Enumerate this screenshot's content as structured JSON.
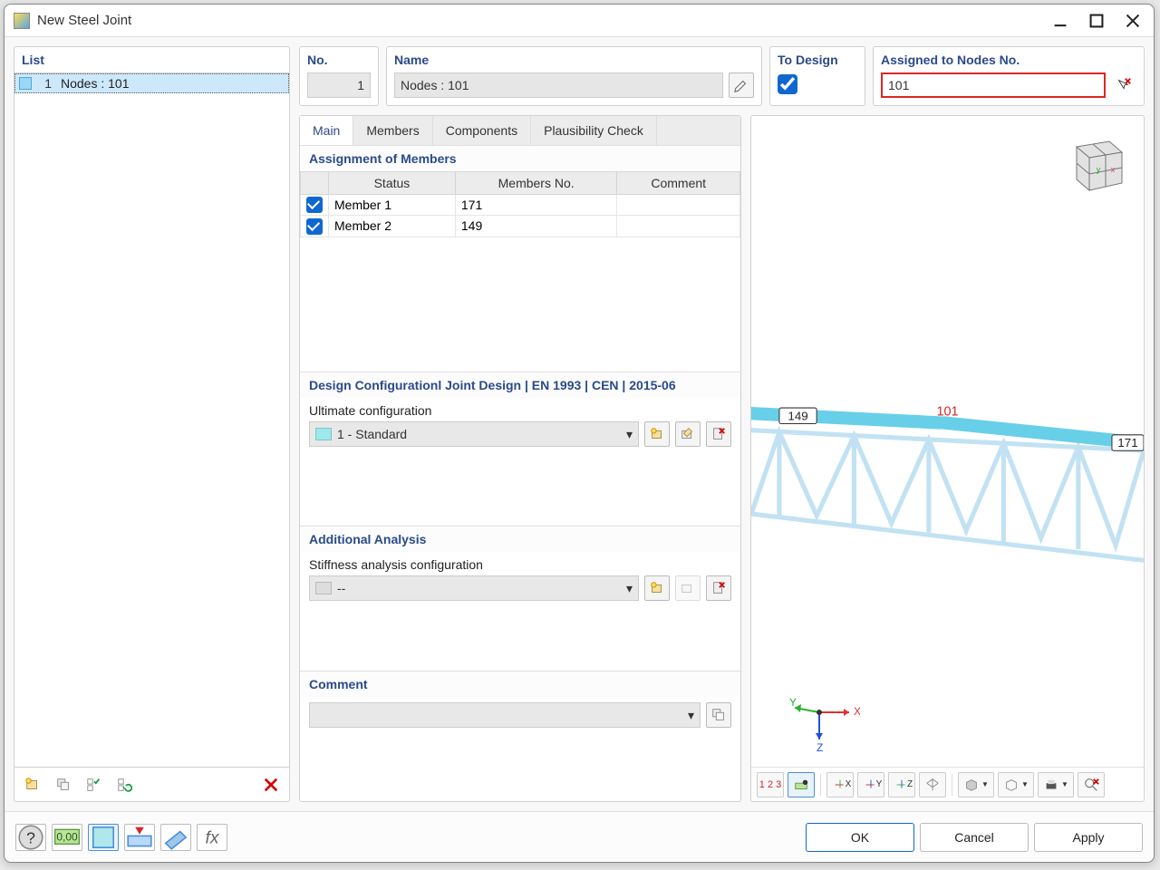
{
  "window": {
    "title": "New Steel Joint"
  },
  "list": {
    "header": "List",
    "items": [
      {
        "num": "1",
        "label": "Nodes : 101"
      }
    ]
  },
  "fields": {
    "no_header": "No.",
    "no_value": "1",
    "name_header": "Name",
    "name_value": "Nodes : 101",
    "todesign_header": "To Design",
    "assigned_header": "Assigned to Nodes No.",
    "assigned_value": "101"
  },
  "tabs": {
    "main": "Main",
    "members": "Members",
    "components": "Components",
    "plausibility": "Plausibility Check"
  },
  "assignment": {
    "header": "Assignment of Members",
    "cols": {
      "status": "Status",
      "members_no": "Members No.",
      "comment": "Comment"
    },
    "rows": [
      {
        "status": "Member 1",
        "no": "171",
        "comment": ""
      },
      {
        "status": "Member 2",
        "no": "149",
        "comment": ""
      }
    ]
  },
  "design": {
    "header": "Design Configurationl Joint Design | EN 1993 | CEN | 2015-06",
    "ultimate_label": "Ultimate configuration",
    "ultimate_value": "1 - Standard"
  },
  "analysis": {
    "header": "Additional Analysis",
    "stiffness_label": "Stiffness analysis configuration",
    "stiffness_value": "--"
  },
  "comment": {
    "header": "Comment",
    "value": ""
  },
  "viewer": {
    "labels": {
      "node": "101",
      "member_left": "149",
      "member_right": "171"
    },
    "axes": {
      "x": "X",
      "y": "Y",
      "z": "Z"
    },
    "toolbar": {
      "b123": "1 2 3",
      "bX": "X",
      "bY": "Y",
      "bZ": "Z"
    }
  },
  "footer": {
    "ok": "OK",
    "cancel": "Cancel",
    "apply": "Apply"
  }
}
